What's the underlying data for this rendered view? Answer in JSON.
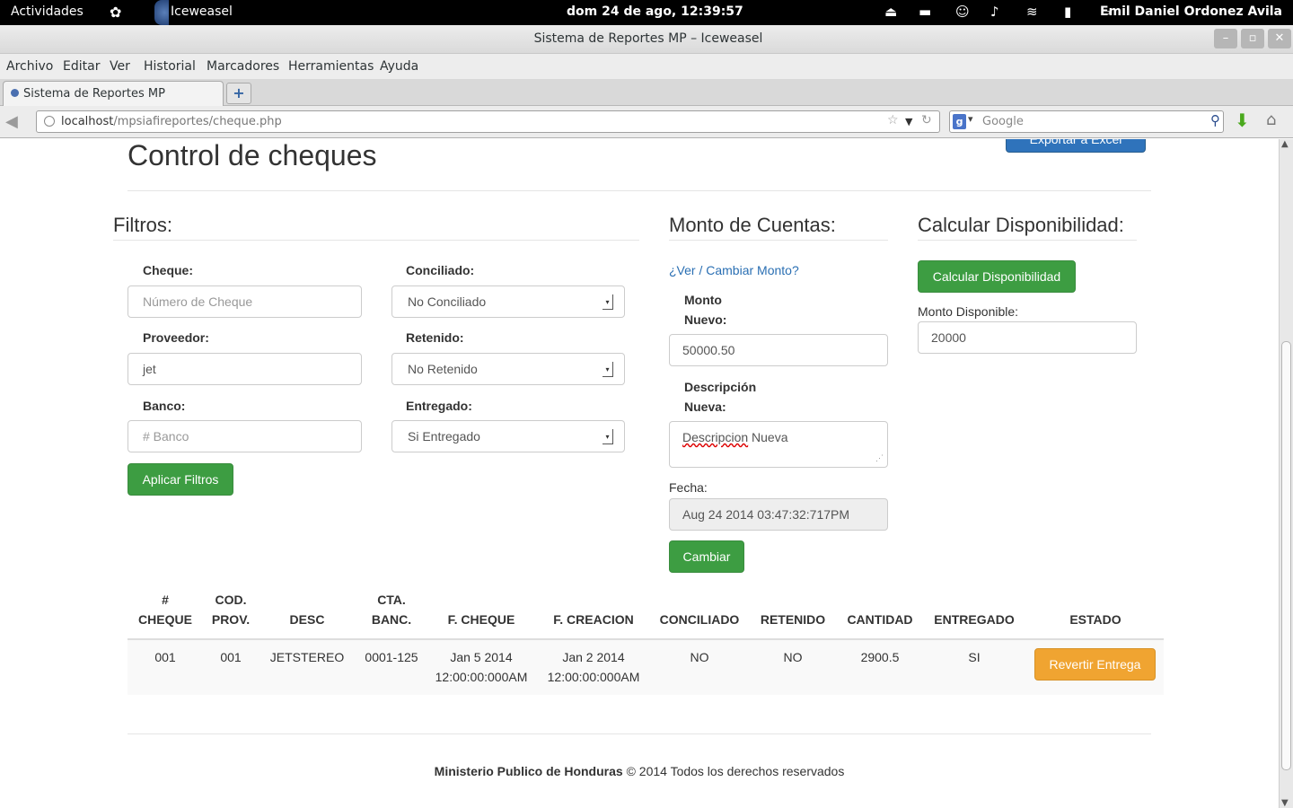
{
  "topbar": {
    "activities": "Actividades",
    "app_name": "Iceweasel",
    "clock": "dom 24 de ago, 12:39:57",
    "user": "Emil Daniel Ordonez Avila"
  },
  "window": {
    "title": "Sistema de Reportes MP – Iceweasel"
  },
  "menu": [
    "Archivo",
    "Editar",
    "Ver",
    "Historial",
    "Marcadores",
    "Herramientas",
    "Ayuda"
  ],
  "tab": {
    "label": "Sistema de Reportes MP",
    "new_tab_symbol": "+"
  },
  "address": {
    "host": "localhost",
    "path": "/mpsiafireportes/cheque.php"
  },
  "search": {
    "placeholder": "Google"
  },
  "page": {
    "title": "Control de cheques",
    "export_button": "Exportar a Excel",
    "filters": {
      "heading": "Filtros:",
      "cheque_label": "Cheque:",
      "cheque_placeholder": "Número de Cheque",
      "proveedor_label": "Proveedor:",
      "proveedor_value": "jet",
      "banco_label": "Banco:",
      "banco_placeholder": "# Banco",
      "conciliado_label": "Conciliado:",
      "conciliado_value": "No Conciliado",
      "retenido_label": "Retenido:",
      "retenido_value": "No Retenido",
      "entregado_label": "Entregado:",
      "entregado_value": "Si Entregado",
      "apply_button": "Aplicar Filtros"
    },
    "monto": {
      "heading": "Monto de Cuentas:",
      "link": "¿Ver / Cambiar Monto?",
      "monto_label_1": "Monto",
      "monto_label_2": "Nuevo:",
      "monto_value": "50000.50",
      "desc_label_1": "Descripción",
      "desc_label_2": "Nueva:",
      "desc_word_1": "Descripcion",
      "desc_word_2": "Nueva",
      "fecha_label": "Fecha:",
      "fecha_value": "Aug 24 2014 03:47:32:717PM",
      "change_button": "Cambiar"
    },
    "disponibilidad": {
      "heading": "Calcular Disponibilidad:",
      "button": "Calcular Disponibilidad",
      "label": "Monto Disponible:",
      "value": "20000"
    },
    "table": {
      "headers": [
        [
          "#",
          "CHEQUE"
        ],
        [
          "COD.",
          "PROV."
        ],
        [
          "",
          "DESC"
        ],
        [
          "CTA.",
          "BANC."
        ],
        [
          "",
          "F. CHEQUE"
        ],
        [
          "",
          "F. CREACION"
        ],
        [
          "",
          "CONCILIADO"
        ],
        [
          "",
          "RETENIDO"
        ],
        [
          "",
          "CANTIDAD"
        ],
        [
          "",
          "ENTREGADO"
        ],
        [
          "",
          "ESTADO"
        ]
      ],
      "row": {
        "cheque": "001",
        "cod_prov": "001",
        "desc": "JETSTEREO",
        "cta_banc": "0001-125",
        "f_cheque_1": "Jan 5 2014",
        "f_cheque_2": "12:00:00:000AM",
        "f_creacion_1": "Jan 2 2014",
        "f_creacion_2": "12:00:00:000AM",
        "conciliado": "NO",
        "retenido": "NO",
        "cantidad": "2900.5",
        "entregado": "SI",
        "estado_button": "Revertir Entrega"
      }
    },
    "footer": {
      "org": "Ministerio Publico de Honduras",
      "rest": " © 2014 Todos los derechos reservados"
    }
  }
}
